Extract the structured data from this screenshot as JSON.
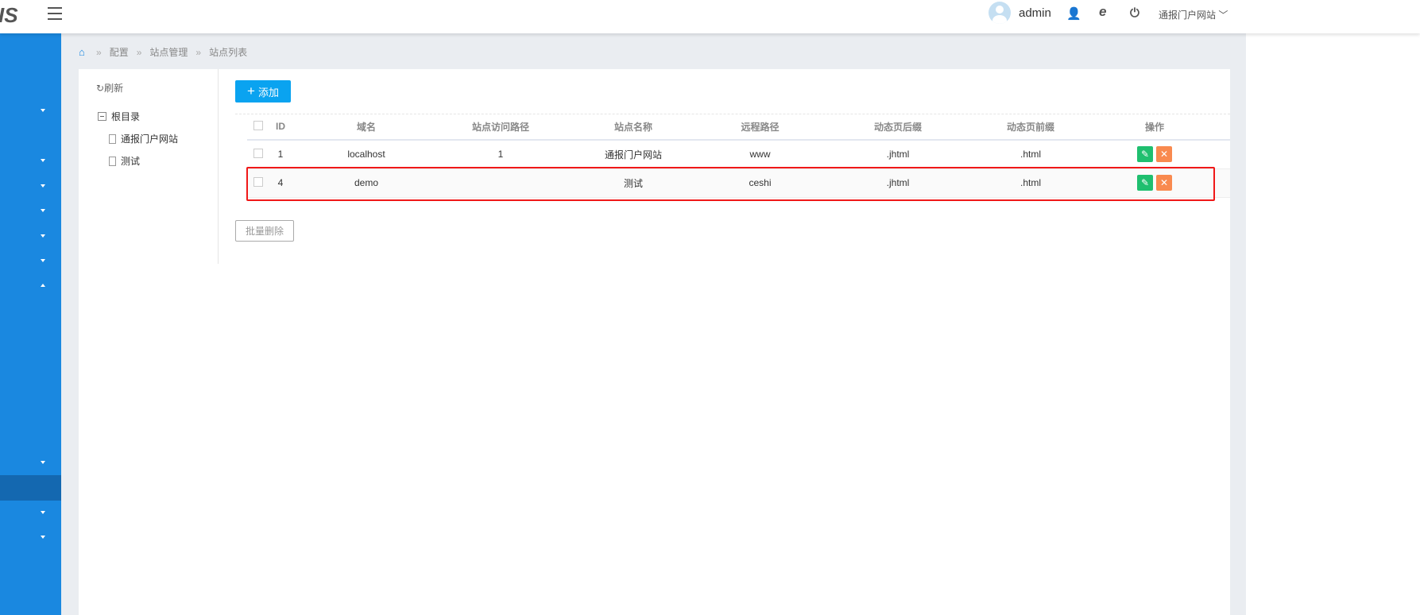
{
  "header": {
    "logo": "IS",
    "username": "admin",
    "site_selector": "通报门户网站",
    "icons": [
      "menu-icon",
      "user-edit-icon",
      "ie-icon",
      "power-icon"
    ]
  },
  "breadcrumb": [
    "配置",
    "站点管理",
    "站点列表"
  ],
  "tree": {
    "refresh": "刷新",
    "root": "根目录",
    "children": [
      "通报门户网站",
      "测试"
    ]
  },
  "toolbar": {
    "add": "添加",
    "bulk_delete": "批量删除"
  },
  "table": {
    "headers": [
      "ID",
      "域名",
      "站点访问路径",
      "站点名称",
      "远程路径",
      "动态页后缀",
      "动态页前缀",
      "操作"
    ],
    "rows": [
      {
        "id": "1",
        "domain": "localhost",
        "path": "1",
        "name": "通报门户网站",
        "remote": "www",
        "suffix": ".jhtml",
        "prefix": ".html"
      },
      {
        "id": "4",
        "domain": "demo",
        "path": "",
        "name": "测试",
        "remote": "ceshi",
        "suffix": ".jhtml",
        "prefix": ".html"
      }
    ]
  },
  "colors": {
    "sidebar": "#1a88e0",
    "add_button": "#0aa3f0",
    "edit": "#1fbf6f",
    "delete": "#f98a4f",
    "highlight": "#f01818"
  }
}
